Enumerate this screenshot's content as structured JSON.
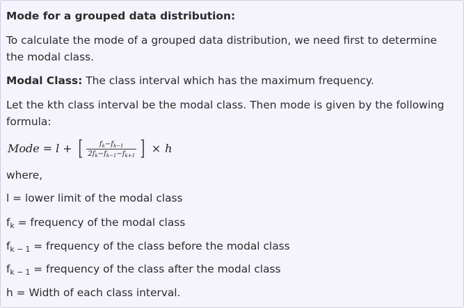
{
  "heading": "Mode for a grouped data distribution:",
  "intro": {
    "line1": "To calculate the mode of a grouped data distribution, we need first to determine",
    "line2": "the modal class."
  },
  "modal_class": {
    "label": "Modal Class:",
    "text": " The class interval which has the maximum frequency."
  },
  "kth": {
    "line1": "Let the kth class interval be the modal class. Then mode is given by the following",
    "line2": "formula:"
  },
  "formula": {
    "lhs": "Mode",
    "equals": "=",
    "l": "l",
    "plus": "+",
    "left_bracket": "[",
    "num_f1": "f",
    "num_sub1": "k",
    "num_minus": "−",
    "num_f2": "f",
    "num_sub2": "k−1",
    "den_coef": "2",
    "den_f1": "f",
    "den_sub1": "k",
    "den_minus1": "−",
    "den_f2": "f",
    "den_sub2": "k−1",
    "den_minus2": "−",
    "den_f3": "f",
    "den_sub3": "k+1",
    "right_bracket": "]",
    "times": "×",
    "h": "h"
  },
  "where": "where,",
  "defs": [
    {
      "symbol": "l",
      "sub": "",
      "text": " = lower limit of the modal class"
    },
    {
      "symbol": "f",
      "sub": "k",
      "text": " = frequency of the modal class"
    },
    {
      "symbol": "f",
      "sub": "k − 1",
      "text": " = frequency of the class before the modal class"
    },
    {
      "symbol": "f",
      "sub": "k − 1",
      "text": " = frequency of the class after the modal class"
    },
    {
      "symbol": "h",
      "sub": "",
      "text": " = Width of each class interval."
    }
  ]
}
